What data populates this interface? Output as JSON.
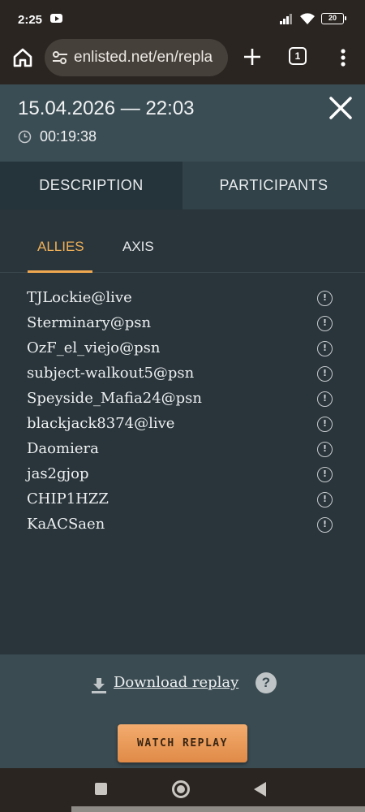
{
  "status_bar": {
    "time": "2:25",
    "battery": "20",
    "icons": [
      "youtube-icon",
      "signal-icon",
      "wifi-icon",
      "battery-icon"
    ]
  },
  "browser": {
    "url": "enlisted.net/en/repla",
    "tab_count": "1",
    "icons": [
      "home-icon",
      "site-settings-icon",
      "plus-icon",
      "tabs-icon",
      "more-vert-icon"
    ]
  },
  "replay": {
    "date_title": "15.04.2026 — 22:03",
    "duration": "00:19:38",
    "icons": [
      "close-icon",
      "clock-icon"
    ]
  },
  "tabs": {
    "description": "DESCRIPTION",
    "participants": "PARTICIPANTS",
    "active": "participants"
  },
  "team_tabs": {
    "allies": "ALLIES",
    "axis": "AXIS",
    "active": "allies",
    "accent_color": "#f0a850"
  },
  "players": [
    {
      "name": "TJLockie@live"
    },
    {
      "name": "Sterminary@psn"
    },
    {
      "name": "OzF_el_viejo@psn"
    },
    {
      "name": "subject-walkout5@psn"
    },
    {
      "name": "Speyside_Mafia24@psn"
    },
    {
      "name": "blackjack8374@live"
    },
    {
      "name": "Daomiera"
    },
    {
      "name": "jas2gjop"
    },
    {
      "name": "CHIP1HZZ"
    },
    {
      "name": "KaACSaen"
    }
  ],
  "footer": {
    "download_label": "Download replay",
    "help_symbol": "?",
    "watch_label": "WATCH REPLAY",
    "watch_color": "#e99b58"
  },
  "nav_bar": {
    "icons": [
      "recents-icon",
      "home-circle-icon",
      "back-icon"
    ]
  }
}
